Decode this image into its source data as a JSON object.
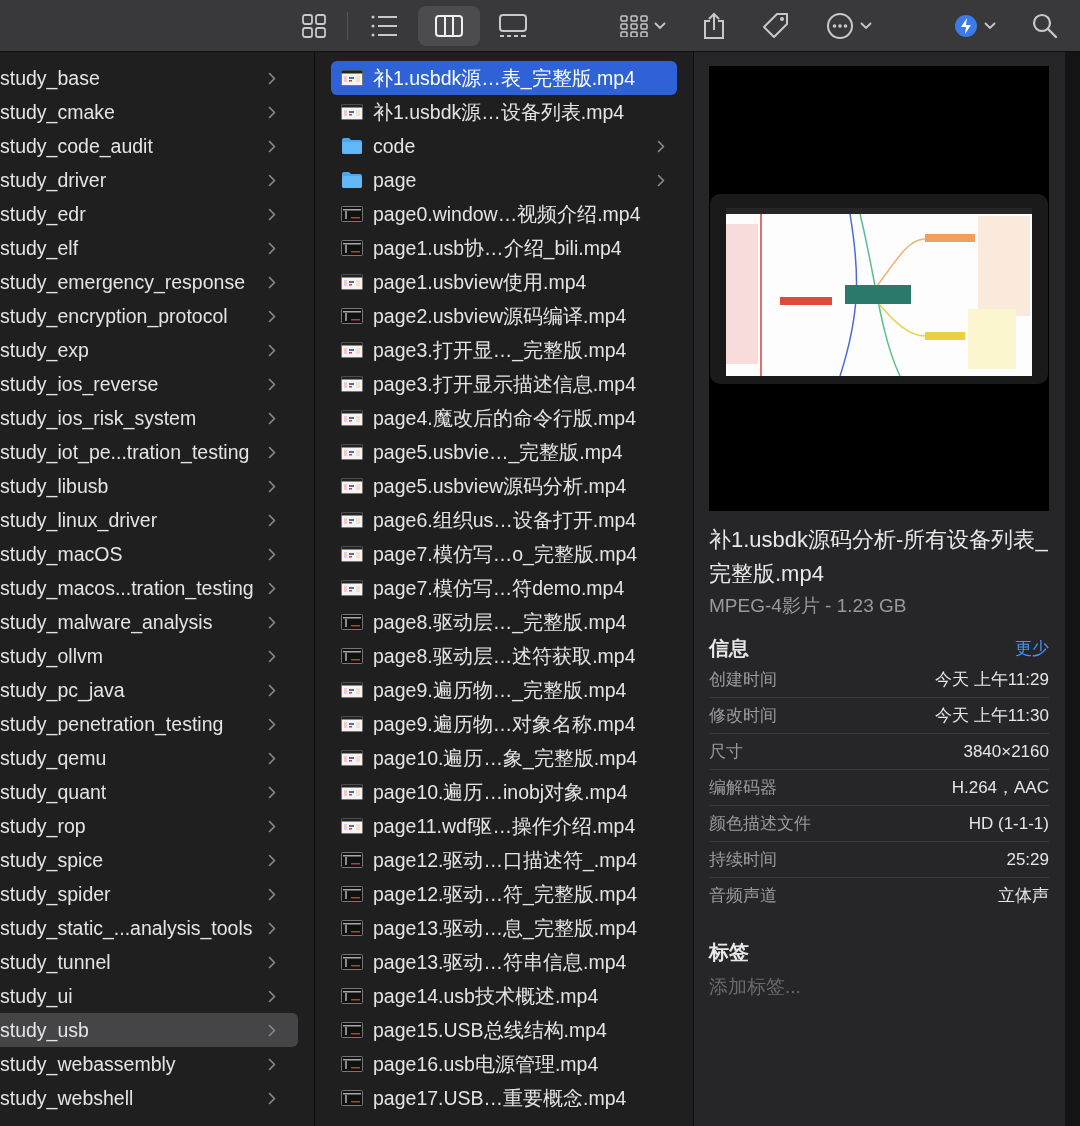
{
  "toolbar": {
    "view_buttons": [
      {
        "selected": false
      },
      {
        "selected": false
      },
      {
        "selected": true
      },
      {
        "selected": false
      }
    ]
  },
  "sidebar_column": {
    "items": [
      {
        "label": "study_base",
        "selected": false
      },
      {
        "label": "study_cmake",
        "selected": false
      },
      {
        "label": "study_code_audit",
        "selected": false
      },
      {
        "label": "study_driver",
        "selected": false
      },
      {
        "label": "study_edr",
        "selected": false
      },
      {
        "label": "study_elf",
        "selected": false
      },
      {
        "label": "study_emergency_response",
        "selected": false
      },
      {
        "label": "study_encryption_protocol",
        "selected": false
      },
      {
        "label": "study_exp",
        "selected": false
      },
      {
        "label": "study_ios_reverse",
        "selected": false
      },
      {
        "label": "study_ios_risk_system",
        "selected": false
      },
      {
        "label": "study_iot_pe...tration_testing",
        "selected": false
      },
      {
        "label": "study_libusb",
        "selected": false
      },
      {
        "label": "study_linux_driver",
        "selected": false
      },
      {
        "label": "study_macOS",
        "selected": false
      },
      {
        "label": "study_macos...tration_testing",
        "selected": false
      },
      {
        "label": "study_malware_analysis",
        "selected": false
      },
      {
        "label": "study_ollvm",
        "selected": false
      },
      {
        "label": "study_pc_java",
        "selected": false
      },
      {
        "label": "study_penetration_testing",
        "selected": false
      },
      {
        "label": "study_qemu",
        "selected": false
      },
      {
        "label": "study_quant",
        "selected": false
      },
      {
        "label": "study_rop",
        "selected": false
      },
      {
        "label": "study_spice",
        "selected": false
      },
      {
        "label": "study_spider",
        "selected": false
      },
      {
        "label": "study_static_...analysis_tools",
        "selected": false
      },
      {
        "label": "study_tunnel",
        "selected": false
      },
      {
        "label": "study_ui",
        "selected": false
      },
      {
        "label": "study_usb",
        "selected": true
      },
      {
        "label": "study_webassembly",
        "selected": false
      },
      {
        "label": "study_webshell",
        "selected": false
      }
    ]
  },
  "file_column": {
    "items": [
      {
        "label": "补1.usbdk源…表_完整版.mp4",
        "kind": "video_light",
        "selected": true
      },
      {
        "label": "补1.usbdk源…设备列表.mp4",
        "kind": "video_light",
        "selected": false
      },
      {
        "label": "code",
        "kind": "folder",
        "selected": false
      },
      {
        "label": "page",
        "kind": "folder",
        "selected": false
      },
      {
        "label": "page0.window…视频介绍.mp4",
        "kind": "video_dark",
        "selected": false
      },
      {
        "label": "page1.usb协…介绍_bili.mp4",
        "kind": "video_dark",
        "selected": false
      },
      {
        "label": "page1.usbview使用.mp4",
        "kind": "video_light",
        "selected": false
      },
      {
        "label": "page2.usbview源码编译.mp4",
        "kind": "video_dark",
        "selected": false
      },
      {
        "label": "page3.打开显…_完整版.mp4",
        "kind": "video_light",
        "selected": false
      },
      {
        "label": "page3.打开显示描述信息.mp4",
        "kind": "video_light",
        "selected": false
      },
      {
        "label": "page4.魔改后的命令行版.mp4",
        "kind": "video_light",
        "selected": false
      },
      {
        "label": "page5.usbvie…_完整版.mp4",
        "kind": "video_light",
        "selected": false
      },
      {
        "label": "page5.usbview源码分析.mp4",
        "kind": "video_light",
        "selected": false
      },
      {
        "label": "page6.组织us…设备打开.mp4",
        "kind": "video_light",
        "selected": false
      },
      {
        "label": "page7.模仿写…o_完整版.mp4",
        "kind": "video_light",
        "selected": false
      },
      {
        "label": "page7.模仿写…符demo.mp4",
        "kind": "video_light",
        "selected": false
      },
      {
        "label": "page8.驱动层…_完整版.mp4",
        "kind": "video_dark",
        "selected": false
      },
      {
        "label": "page8.驱动层…述符获取.mp4",
        "kind": "video_dark",
        "selected": false
      },
      {
        "label": "page9.遍历物…_完整版.mp4",
        "kind": "video_light",
        "selected": false
      },
      {
        "label": "page9.遍历物…对象名称.mp4",
        "kind": "video_light",
        "selected": false
      },
      {
        "label": "page10.遍历…象_完整版.mp4",
        "kind": "video_light",
        "selected": false
      },
      {
        "label": "page10.遍历…inobj对象.mp4",
        "kind": "video_light",
        "selected": false
      },
      {
        "label": "page11.wdf驱…操作介绍.mp4",
        "kind": "video_light",
        "selected": false
      },
      {
        "label": "page12.驱动…口描述符_.mp4",
        "kind": "video_dark",
        "selected": false
      },
      {
        "label": "page12.驱动…符_完整版.mp4",
        "kind": "video_dark",
        "selected": false
      },
      {
        "label": "page13.驱动…息_完整版.mp4",
        "kind": "video_dark",
        "selected": false
      },
      {
        "label": "page13.驱动…符串信息.mp4",
        "kind": "video_dark",
        "selected": false
      },
      {
        "label": "page14.usb技术概述.mp4",
        "kind": "video_dark",
        "selected": false
      },
      {
        "label": "page15.USB总线结构.mp4",
        "kind": "video_dark",
        "selected": false
      },
      {
        "label": "page16.usb电源管理.mp4",
        "kind": "video_dark",
        "selected": false
      },
      {
        "label": "page17.USB…重要概念.mp4",
        "kind": "video_dark",
        "selected": false
      }
    ]
  },
  "preview": {
    "kind": "picture",
    "title": "补1.usbdk源码分析-所有设备列表_完整版.mp4",
    "subtitle": "MPEG-4影片 - 1.23 GB",
    "info_heading": "信息",
    "toggle_link": "更少",
    "info_rows": [
      {
        "label": "创建时间",
        "value": "今天 上午11:29"
      },
      {
        "label": "修改时间",
        "value": "今天 上午11:30"
      },
      {
        "label": "尺寸",
        "value": "3840×2160"
      },
      {
        "label": "编解码器",
        "value": "H.264，AAC"
      },
      {
        "label": "颜色描述文件",
        "value": "HD (1-1-1)"
      },
      {
        "label": "持续时间",
        "value": "25:29"
      },
      {
        "label": "音频声道",
        "value": "立体声"
      }
    ],
    "tags_heading": "标签",
    "tags_placeholder": "添加标签..."
  }
}
